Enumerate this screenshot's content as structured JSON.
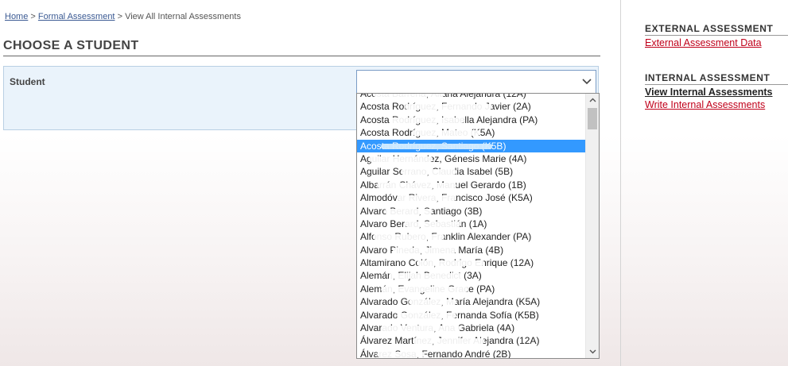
{
  "breadcrumb": {
    "home": "Home",
    "formal": "Formal Assessment",
    "current": "View All Internal Assessments",
    "separator": ">"
  },
  "page": {
    "title": "CHOOSE A STUDENT"
  },
  "form": {
    "student_label": "Student",
    "select_value": ""
  },
  "dropdown": {
    "selected_index": 4,
    "options": [
      "Acosta Barrena, Aitana Alejandra (12A)",
      "Acosta Rodríguez, Fernando Javier (2A)",
      "Acosta Rodríguez, Isabella Alejandra (PA)",
      "Acosta Rodríguez, Mateo (K5A)",
      "Acosta Rodríguez, Santiago (K5B)",
      "Aguilar Hernández, Génesis Marie (4A)",
      "Aguilar Serrano, Claudia Isabel (5B)",
      "Albarrán Chávez, Manuel Gerardo (1B)",
      "Almodóvar Rivera, Francisco José (K5A)",
      "Alvaro Berard, Santiago (3B)",
      "Alvaro Berard, Sebastián (1A)",
      "Alfonso Rubero, Franklin Alexander (PA)",
      "Alvaro Pineda, Jimena María (4B)",
      "Altamirano Colón, Rodrigo Enrique (12A)",
      "Alemán, Elijah Benedict (3A)",
      "Alemán, Evangeline Grace (PA)",
      "Alvarado González, María Alejandra (K5A)",
      "Alvarado González, Fernanda Sofía (K5B)",
      "Alvarado Ventura, Ana Gabriela (4A)",
      "Álvarez Martínez, Jennifer Alejandra (12A)",
      "Álvarez Sosa, Fernando André (2B)"
    ]
  },
  "sidebar": {
    "external_title": "EXTERNAL ASSESSMENT",
    "external_link": "External Assessment Data",
    "internal_title": "INTERNAL ASSESSMENT",
    "internal_view": "View Internal Assessments",
    "internal_write": "Write Internal Assessments"
  },
  "colors": {
    "link_red": "#c0001a",
    "breadcrumb_blue": "#3b5a93",
    "selection_blue": "#3399ff",
    "panel_bg": "#eaf3fb"
  }
}
